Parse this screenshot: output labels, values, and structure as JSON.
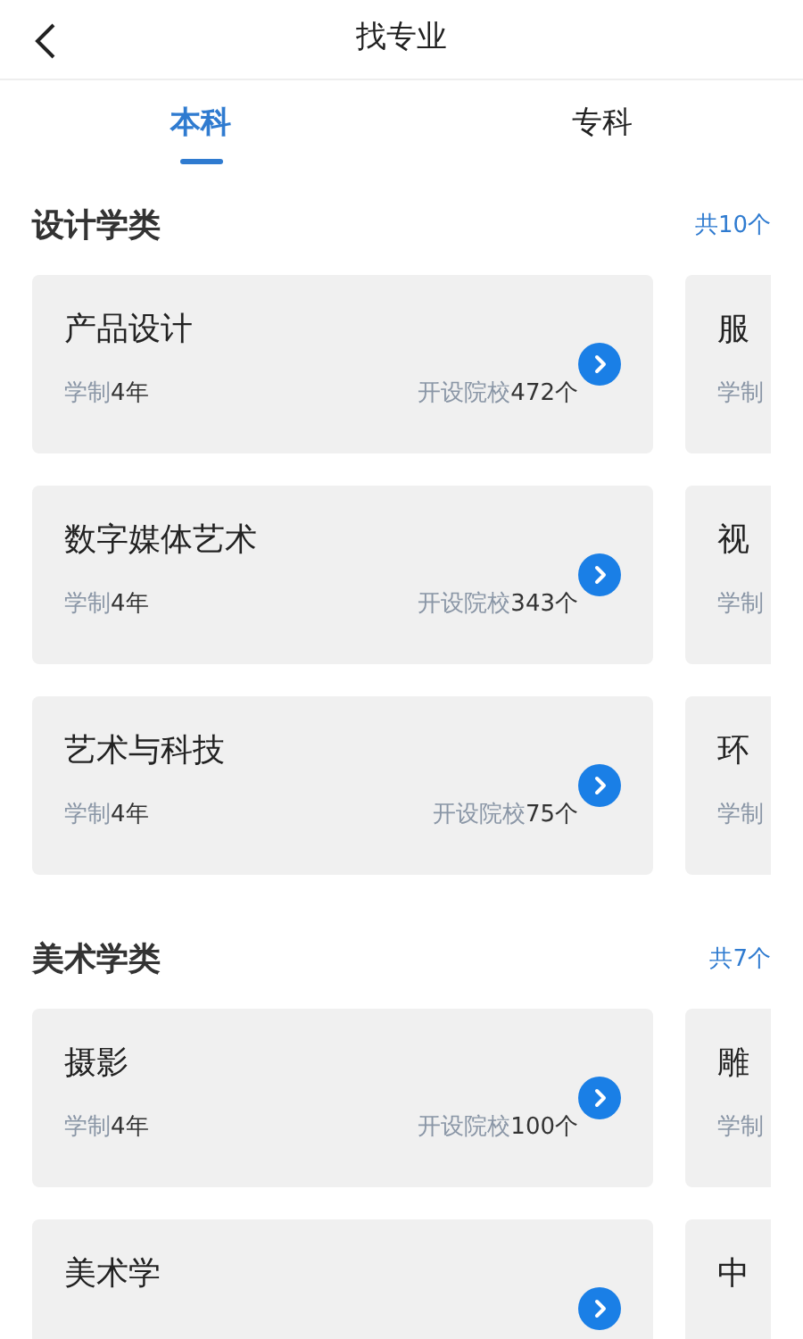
{
  "header": {
    "title": "找专业"
  },
  "tabs": [
    {
      "label": "本科",
      "selected": true
    },
    {
      "label": "专科",
      "selected": false
    }
  ],
  "sections": [
    {
      "title": "设计学类",
      "count": "共10个",
      "rows": [
        {
          "left": {
            "title": "产品设计",
            "duration_label": "学制",
            "duration_value": "4年",
            "schools_label": "开设院校",
            "schools_value": "472个"
          },
          "right": {
            "title": "服",
            "duration_label": "学制"
          }
        },
        {
          "left": {
            "title": "数字媒体艺术",
            "duration_label": "学制",
            "duration_value": "4年",
            "schools_label": "开设院校",
            "schools_value": "343个"
          },
          "right": {
            "title": "视",
            "duration_label": "学制"
          }
        },
        {
          "left": {
            "title": "艺术与科技",
            "duration_label": "学制",
            "duration_value": "4年",
            "schools_label": "开设院校",
            "schools_value": "75个"
          },
          "right": {
            "title": "环",
            "duration_label": "学制"
          }
        }
      ]
    },
    {
      "title": "美术学类",
      "count": "共7个",
      "rows": [
        {
          "left": {
            "title": "摄影",
            "duration_label": "学制",
            "duration_value": "4年",
            "schools_label": "开设院校",
            "schools_value": "100个"
          },
          "right": {
            "title": "雕",
            "duration_label": "学制"
          }
        },
        {
          "left": {
            "title": "美术学"
          },
          "right": {
            "title": "中"
          }
        }
      ]
    }
  ]
}
